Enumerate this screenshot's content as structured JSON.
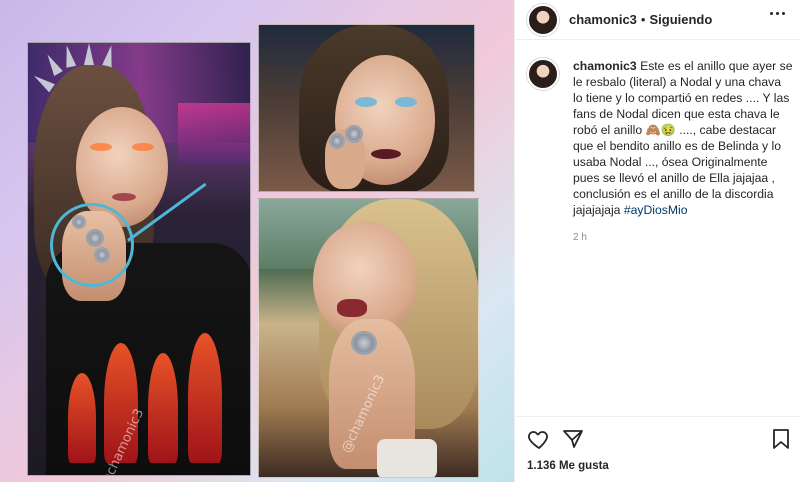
{
  "post": {
    "username": "chamonic3",
    "separator": "•",
    "follow_status": "Siguiendo",
    "caption_user": "chamonic3",
    "caption_text": "Este es el anillo que ayer se le resbalo (literal) a Nodal y una chava lo tiene y lo compartió en redes .... Y las fans de Nodal dicen que esta chava le robó el anillo 🙈🤢 ...., cabe destacar que el bendito anillo es de Belinda y lo usaba Nodal ..., ósea Originalmente pues se llevó el anillo de Ella jajajaa , conclusión es el anillo de la discordia jajajajaja",
    "hashtag": "#ayDiosMio",
    "time_ago": "2 h",
    "likes_count": "1.136 Me gusta"
  },
  "watermark": "@chamonic3",
  "icons": {
    "more": "more-options-icon",
    "like": "heart-icon",
    "share": "paper-plane-icon",
    "save": "bookmark-icon"
  },
  "colors": {
    "text": "#262626",
    "muted": "#8e8e8e",
    "hashtag": "#00376b",
    "annotation": "#4fb7d6"
  }
}
